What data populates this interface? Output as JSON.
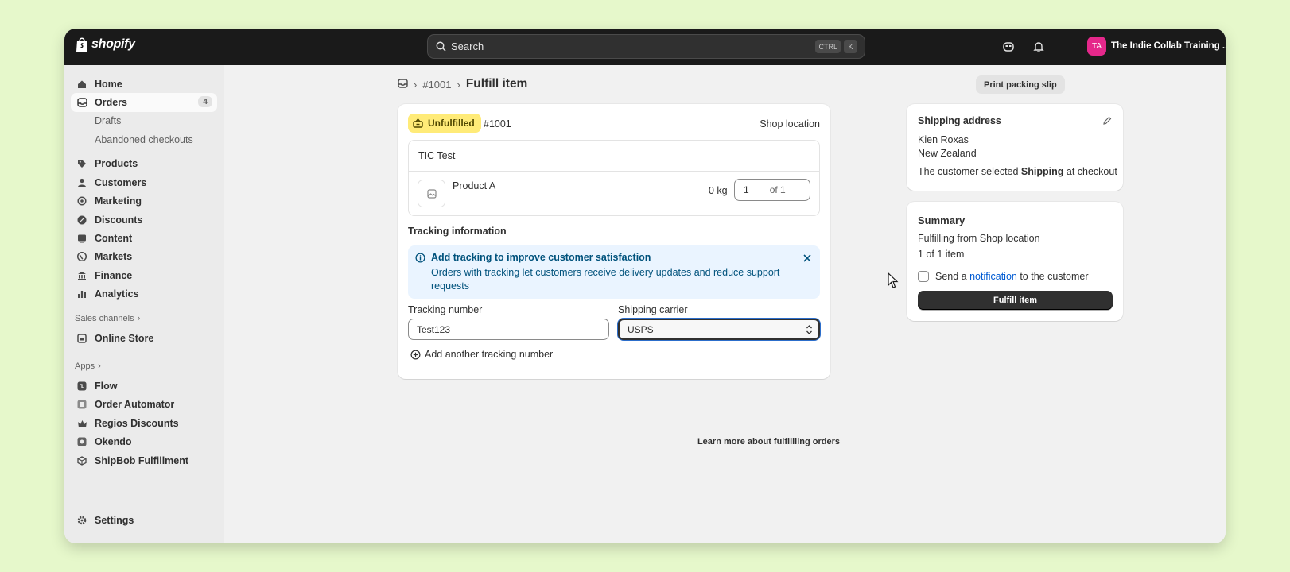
{
  "topbar": {
    "logo": "shopify",
    "search_placeholder": "Search",
    "shortcut_keys": [
      "CTRL",
      "K"
    ],
    "store_initials": "TA",
    "store_name": "The Indie Collab Training ..."
  },
  "sidebar": {
    "items": [
      {
        "label": "Home",
        "icon": "home-icon"
      },
      {
        "label": "Orders",
        "icon": "inbox-icon",
        "badge": "4",
        "active": true
      },
      {
        "label": "Drafts"
      },
      {
        "label": "Abandoned checkouts"
      },
      {
        "label": "Products",
        "icon": "tag-icon"
      },
      {
        "label": "Customers",
        "icon": "person-icon"
      },
      {
        "label": "Marketing",
        "icon": "target-icon"
      },
      {
        "label": "Discounts",
        "icon": "discount-icon"
      },
      {
        "label": "Content",
        "icon": "content-icon"
      },
      {
        "label": "Markets",
        "icon": "globe-icon"
      },
      {
        "label": "Finance",
        "icon": "bank-icon"
      },
      {
        "label": "Analytics",
        "icon": "chart-icon"
      }
    ],
    "sales_channels_label": "Sales channels",
    "online_store_label": "Online Store",
    "apps_label": "Apps",
    "apps": [
      "Flow",
      "Order Automator",
      "Regios Discounts",
      "Okendo",
      "ShipBob Fulfillment"
    ],
    "settings_label": "Settings"
  },
  "breadcrumb": {
    "order": "#1001",
    "title": "Fulfill item"
  },
  "print_label": "Print packing slip",
  "fulfillment": {
    "status": "Unfulfilled",
    "order": "#1001",
    "location": "Shop location",
    "group_title": "TIC Test",
    "product_name": "Product A",
    "weight": "0 kg",
    "quantity": "1",
    "quantity_of": "of 1"
  },
  "tracking": {
    "title": "Tracking information",
    "banner_title": "Add tracking to improve customer satisfaction",
    "banner_text": "Orders with tracking let customers receive delivery updates and reduce support requests",
    "number_label": "Tracking number",
    "number_value": "Test123",
    "carrier_label": "Shipping carrier",
    "carrier_value": "USPS",
    "add_another": "Add another tracking number"
  },
  "shipping_address": {
    "title": "Shipping address",
    "name": "Kien Roxas",
    "country": "New Zealand",
    "note_prefix": "The customer selected ",
    "note_bold": "Shipping",
    "note_suffix": " at checkout"
  },
  "summary": {
    "title": "Summary",
    "from": "Fulfilling from Shop location",
    "count": "1 of 1 item",
    "notify_prefix": "Send a ",
    "notify_link": "notification",
    "notify_suffix": " to the customer",
    "button": "Fulfill item"
  },
  "learn_more": "Learn more about fulfillling orders",
  "colors": {
    "background": "#e6f8cb",
    "topbar": "#1a1a1a",
    "badge_unfulfilled": "#ffeb78",
    "info_banner": "#eaf4ff",
    "link": "#005bd3",
    "avatar": "#e5288b"
  }
}
